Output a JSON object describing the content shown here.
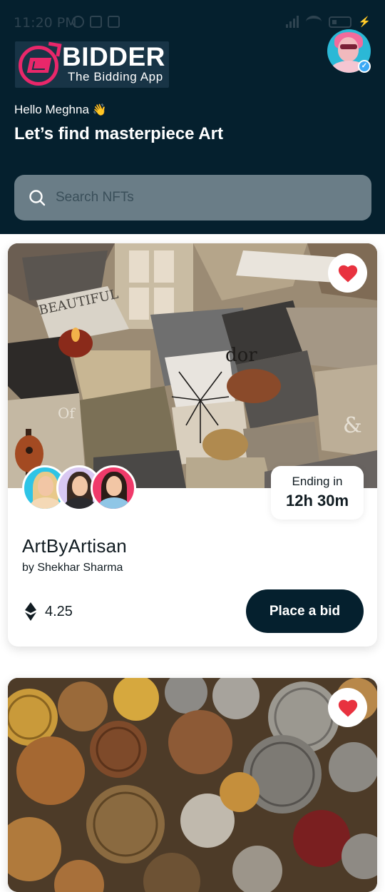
{
  "status_bar": {
    "time": "11:20 PM"
  },
  "logo": {
    "title": "BIDDER",
    "subtitle": "The Bidding App"
  },
  "greeting": {
    "hello": "Hello Meghna",
    "emoji": "👋",
    "headline": "Let’s find masterpiece Art"
  },
  "search": {
    "placeholder": "Search NFTs"
  },
  "cards": [
    {
      "title": "ArtByArtisan",
      "author": "by Shekhar Sharma",
      "price": "4.25",
      "ending_label": "Ending in",
      "ending_time": "12h 30m",
      "bid_label": "Place a bid",
      "favorited": true
    },
    {
      "favorited": true
    }
  ],
  "colors": {
    "brand_dark": "#05202e",
    "accent_pink": "#e9276a",
    "heart_red": "#e8323f",
    "search_bg": "#6a7d87"
  }
}
